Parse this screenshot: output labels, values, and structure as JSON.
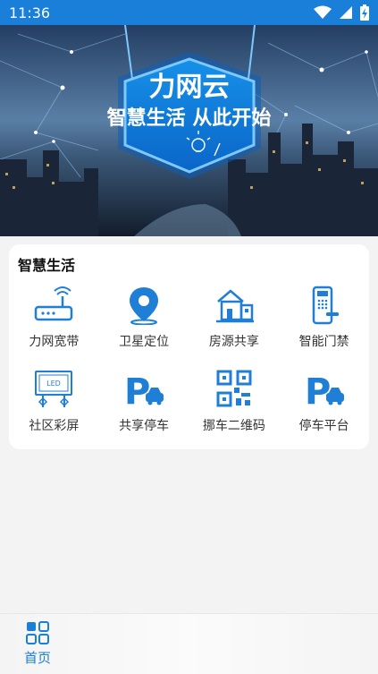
{
  "status_bar": {
    "time": "11:36",
    "icons": [
      "wifi-icon",
      "signal-icon",
      "battery-charging-icon"
    ]
  },
  "banner": {
    "title": "力网云",
    "slogan": "智慧生活 从此开始"
  },
  "section": {
    "title": "智慧生活",
    "items": [
      {
        "label": "力网宽带",
        "icon": "router-icon"
      },
      {
        "label": "卫星定位",
        "icon": "location-pin-icon"
      },
      {
        "label": "房源共享",
        "icon": "house-icon"
      },
      {
        "label": "智能门禁",
        "icon": "smart-lock-icon"
      },
      {
        "label": "社区彩屏",
        "icon": "led-screen-icon"
      },
      {
        "label": "共享停车",
        "icon": "parking-car-icon"
      },
      {
        "label": "挪车二维码",
        "icon": "qr-code-icon"
      },
      {
        "label": "停车平台",
        "icon": "parking-platform-icon"
      }
    ]
  },
  "bottom_nav": {
    "home_label": "首页",
    "home_icon": "grid-home-icon"
  },
  "colors": {
    "accent": "#1a7fd8",
    "icon_blue": "#1f7fd6"
  }
}
